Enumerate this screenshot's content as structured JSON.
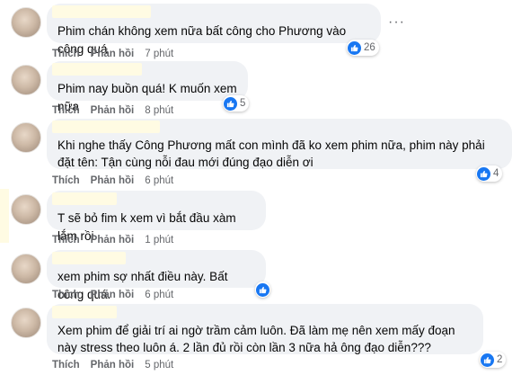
{
  "comments": [
    {
      "text": "Phim chán không xem nữa bất công cho Phương vào công quá",
      "like": "Thích",
      "reply": "Phản hồi",
      "time": "7 phút",
      "reactions": "26"
    },
    {
      "text": "Phim nay buồn quá! K muốn xem nữa",
      "like": "Thích",
      "reply": "Phản hồi",
      "time": "8 phút",
      "reactions": "5"
    },
    {
      "text": "Khi nghe thấy Công Phương mất con mình đã ko xem phim nữa, phim này phải đặt tên: Tận cùng nỗi đau mới đúng đạo diễn ơi",
      "like": "Thích",
      "reply": "Phản hồi",
      "time": "6 phút",
      "reactions": "4"
    },
    {
      "text": "T sẽ bỏ fim k xem vì bắt đầu xàm lắm rồi",
      "like": "Thích",
      "reply": "Phản hồi",
      "time": "1 phút",
      "reactions": ""
    },
    {
      "text": "xem phim sợ nhất điều này. Bất công quá.",
      "like": "Thích",
      "reply": "Phản hồi",
      "time": "6 phút",
      "reactions": ""
    },
    {
      "text": "Xem phim để giải trí ai ngờ trầm cảm luôn. Đã làm mẹ nên xem mấy đoạn này stress theo luôn á. 2 lần đủ rồi còn lần 3 nữa hả ông đạo diễn???",
      "like": "Thích",
      "reply": "Phản hồi",
      "time": "5 phút",
      "reactions": "2"
    }
  ],
  "more_glyph": "···"
}
